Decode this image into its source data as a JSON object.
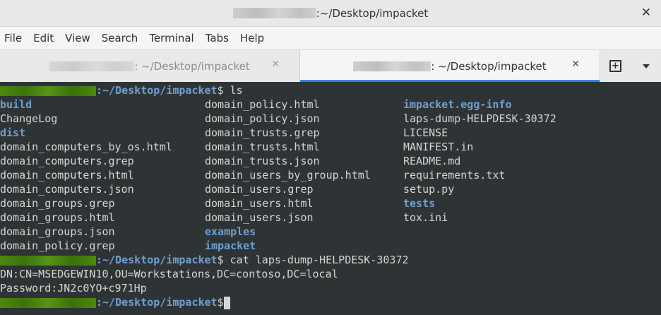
{
  "window": {
    "title_suffix": ":~/Desktop/impacket",
    "close_label": "✕"
  },
  "menu": [
    "File",
    "Edit",
    "View",
    "Search",
    "Terminal",
    "Tabs",
    "Help"
  ],
  "tabs": [
    {
      "title": ": ~/Desktop/impacket",
      "active": false
    },
    {
      "title": ": ~/Desktop/impacket",
      "active": true
    }
  ],
  "tab_close_label": "✕",
  "terminal": {
    "prompt_path": ":~/Desktop/impacket",
    "prompt_symbol": "$",
    "cmd1": " ls",
    "ls_columns": [
      [
        {
          "name": "build",
          "dir": true
        },
        {
          "name": "ChangeLog",
          "dir": false
        },
        {
          "name": "dist",
          "dir": true
        },
        {
          "name": "domain_computers_by_os.html",
          "dir": false
        },
        {
          "name": "domain_computers.grep",
          "dir": false
        },
        {
          "name": "domain_computers.html",
          "dir": false
        },
        {
          "name": "domain_computers.json",
          "dir": false
        },
        {
          "name": "domain_groups.grep",
          "dir": false
        },
        {
          "name": "domain_groups.html",
          "dir": false
        },
        {
          "name": "domain_groups.json",
          "dir": false
        },
        {
          "name": "domain_policy.grep",
          "dir": false
        }
      ],
      [
        {
          "name": "domain_policy.html",
          "dir": false
        },
        {
          "name": "domain_policy.json",
          "dir": false
        },
        {
          "name": "domain_trusts.grep",
          "dir": false
        },
        {
          "name": "domain_trusts.html",
          "dir": false
        },
        {
          "name": "domain_trusts.json",
          "dir": false
        },
        {
          "name": "domain_users_by_group.html",
          "dir": false
        },
        {
          "name": "domain_users.grep",
          "dir": false
        },
        {
          "name": "domain_users.html",
          "dir": false
        },
        {
          "name": "domain_users.json",
          "dir": false
        },
        {
          "name": "examples",
          "dir": true
        },
        {
          "name": "impacket",
          "dir": true
        }
      ],
      [
        {
          "name": "impacket.egg-info",
          "dir": true
        },
        {
          "name": "laps-dump-HELPDESK-30372",
          "dir": false
        },
        {
          "name": "LICENSE",
          "dir": false
        },
        {
          "name": "MANIFEST.in",
          "dir": false
        },
        {
          "name": "README.md",
          "dir": false
        },
        {
          "name": "requirements.txt",
          "dir": false
        },
        {
          "name": "setup.py",
          "dir": false
        },
        {
          "name": "tests",
          "dir": true
        },
        {
          "name": "tox.ini",
          "dir": false
        }
      ]
    ],
    "cmd2": " cat laps-dump-HELPDESK-30372",
    "output": [
      "DN:CN=MSEDGEWIN10,OU=Workstations,DC=contoso,DC=local",
      "Password:JN2c0YO+c971Hp"
    ]
  },
  "colors": {
    "terminal_bg": "#2e3436",
    "terminal_fg": "#d3d7cf",
    "directory": "#729fcf",
    "prompt_user": "#4e9a06",
    "tab_accent": "#3584e4"
  }
}
